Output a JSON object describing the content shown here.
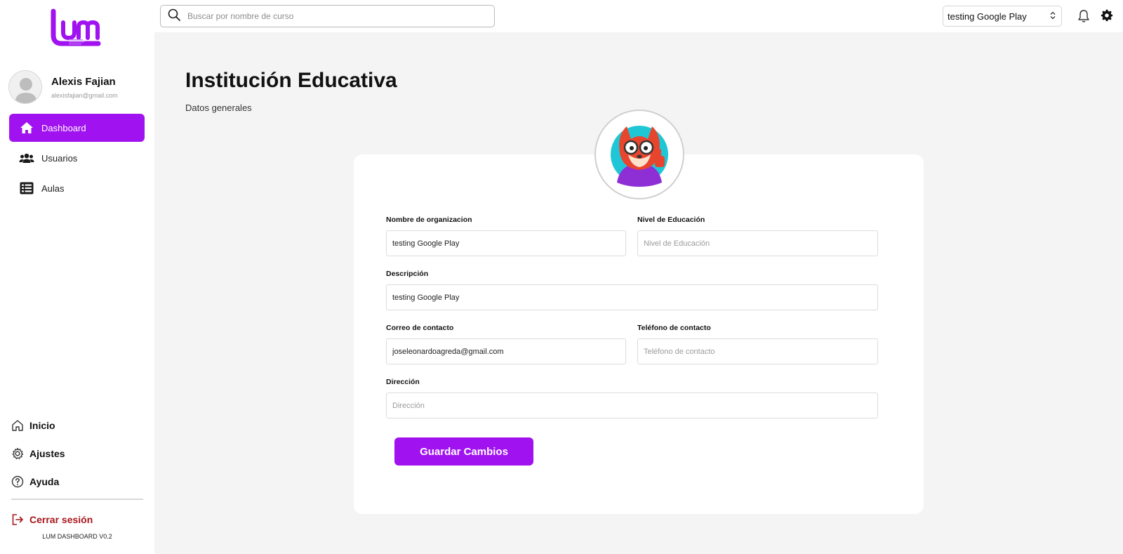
{
  "app": {
    "logo_text": "lum",
    "version": "LUM DASHBOARD V0.2"
  },
  "colors": {
    "accent": "#a112f0",
    "logout": "#a8161c",
    "background": "#f4f4f4"
  },
  "user": {
    "name": "Alexis Fajian",
    "email": "alexisfajian@gmail.com"
  },
  "sidebar": {
    "items": [
      {
        "label": "Dashboard",
        "icon": "home-icon",
        "active": true
      },
      {
        "label": "Usuarios",
        "icon": "users-icon",
        "active": false
      },
      {
        "label": "Aulas",
        "icon": "list-icon",
        "active": false
      }
    ],
    "bottom": {
      "inicio": "Inicio",
      "ajustes": "Ajustes",
      "ayuda": "Ayuda",
      "logout": "Cerrar sesión"
    }
  },
  "topbar": {
    "search_placeholder": "Buscar por nombre de curso",
    "org_selected": "testing Google Play"
  },
  "page": {
    "title": "Institución Educativa",
    "subtitle": "Datos generales"
  },
  "form": {
    "org_name_label": "Nombre de organizacion",
    "org_name_value": "testing Google Play",
    "education_level_label": "Nivel de Educación",
    "education_level_placeholder": "Nivel de Educación",
    "description_label": "Descripción",
    "description_value": "testing Google Play",
    "email_label": "Correo de contacto",
    "email_value": "joseleonardoagreda@gmail.com",
    "phone_label": "Teléfono de contacto",
    "phone_placeholder": "Teléfono de contacto",
    "address_label": "Dirección",
    "address_placeholder": "Dirección",
    "save_label": "Guardar Cambios"
  }
}
